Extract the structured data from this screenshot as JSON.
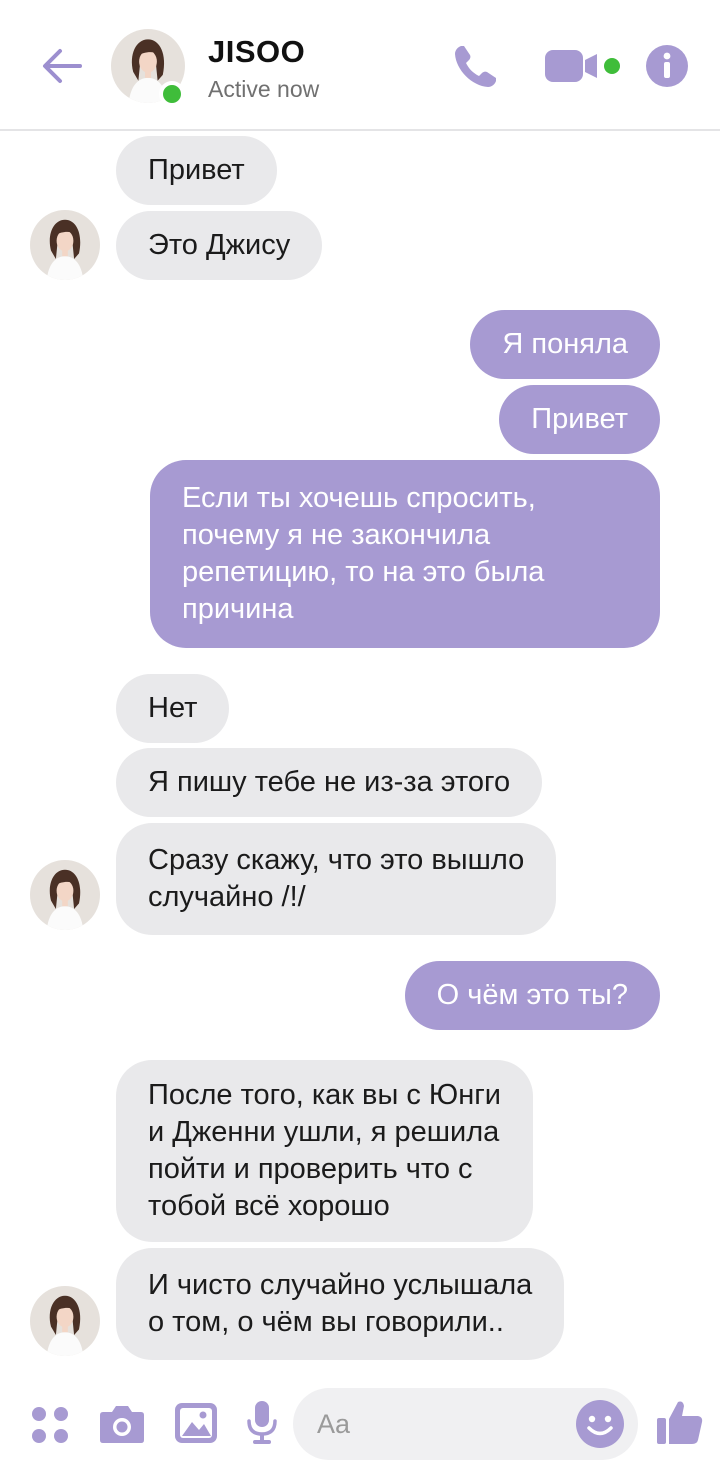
{
  "colors": {
    "accent": "#a79ad2",
    "incoming_bubble": "#e9e9eb",
    "online": "#3fbd3a"
  },
  "header": {
    "name": "JISOO",
    "status": "Active now",
    "icons": [
      "back-arrow-icon",
      "phone-icon",
      "video-camera-icon",
      "info-icon"
    ]
  },
  "messages": [
    {
      "dir": "in",
      "text": "Привет"
    },
    {
      "dir": "in",
      "text": "Это Джису"
    },
    {
      "dir": "out",
      "text": "Я поняла"
    },
    {
      "dir": "out",
      "text": "Привет"
    },
    {
      "dir": "out",
      "lines": [
        "Если ты хочешь спросить,",
        "почему я не закончила",
        "репетицию, то на это была",
        "причина"
      ]
    },
    {
      "dir": "in",
      "text": "Нет"
    },
    {
      "dir": "in",
      "text": "Я пишу тебе не из-за этого"
    },
    {
      "dir": "in",
      "lines": [
        "Сразу скажу, что это вышло",
        "случайно /!/"
      ]
    },
    {
      "dir": "out",
      "text": "О чём это ты?"
    },
    {
      "dir": "in",
      "lines": [
        "После того, как вы с Юнги",
        "и Дженни ушли, я решила",
        "пойти и проверить что с",
        "тобой всё хорошо"
      ]
    },
    {
      "dir": "in",
      "lines": [
        "И чисто случайно услышала",
        "о том, о чём вы говорили.."
      ]
    }
  ],
  "composer": {
    "placeholder": "Aa",
    "icons": [
      "apps-grid-icon",
      "camera-icon",
      "gallery-icon",
      "microphone-icon",
      "emoji-icon",
      "thumbs-up-icon"
    ]
  }
}
